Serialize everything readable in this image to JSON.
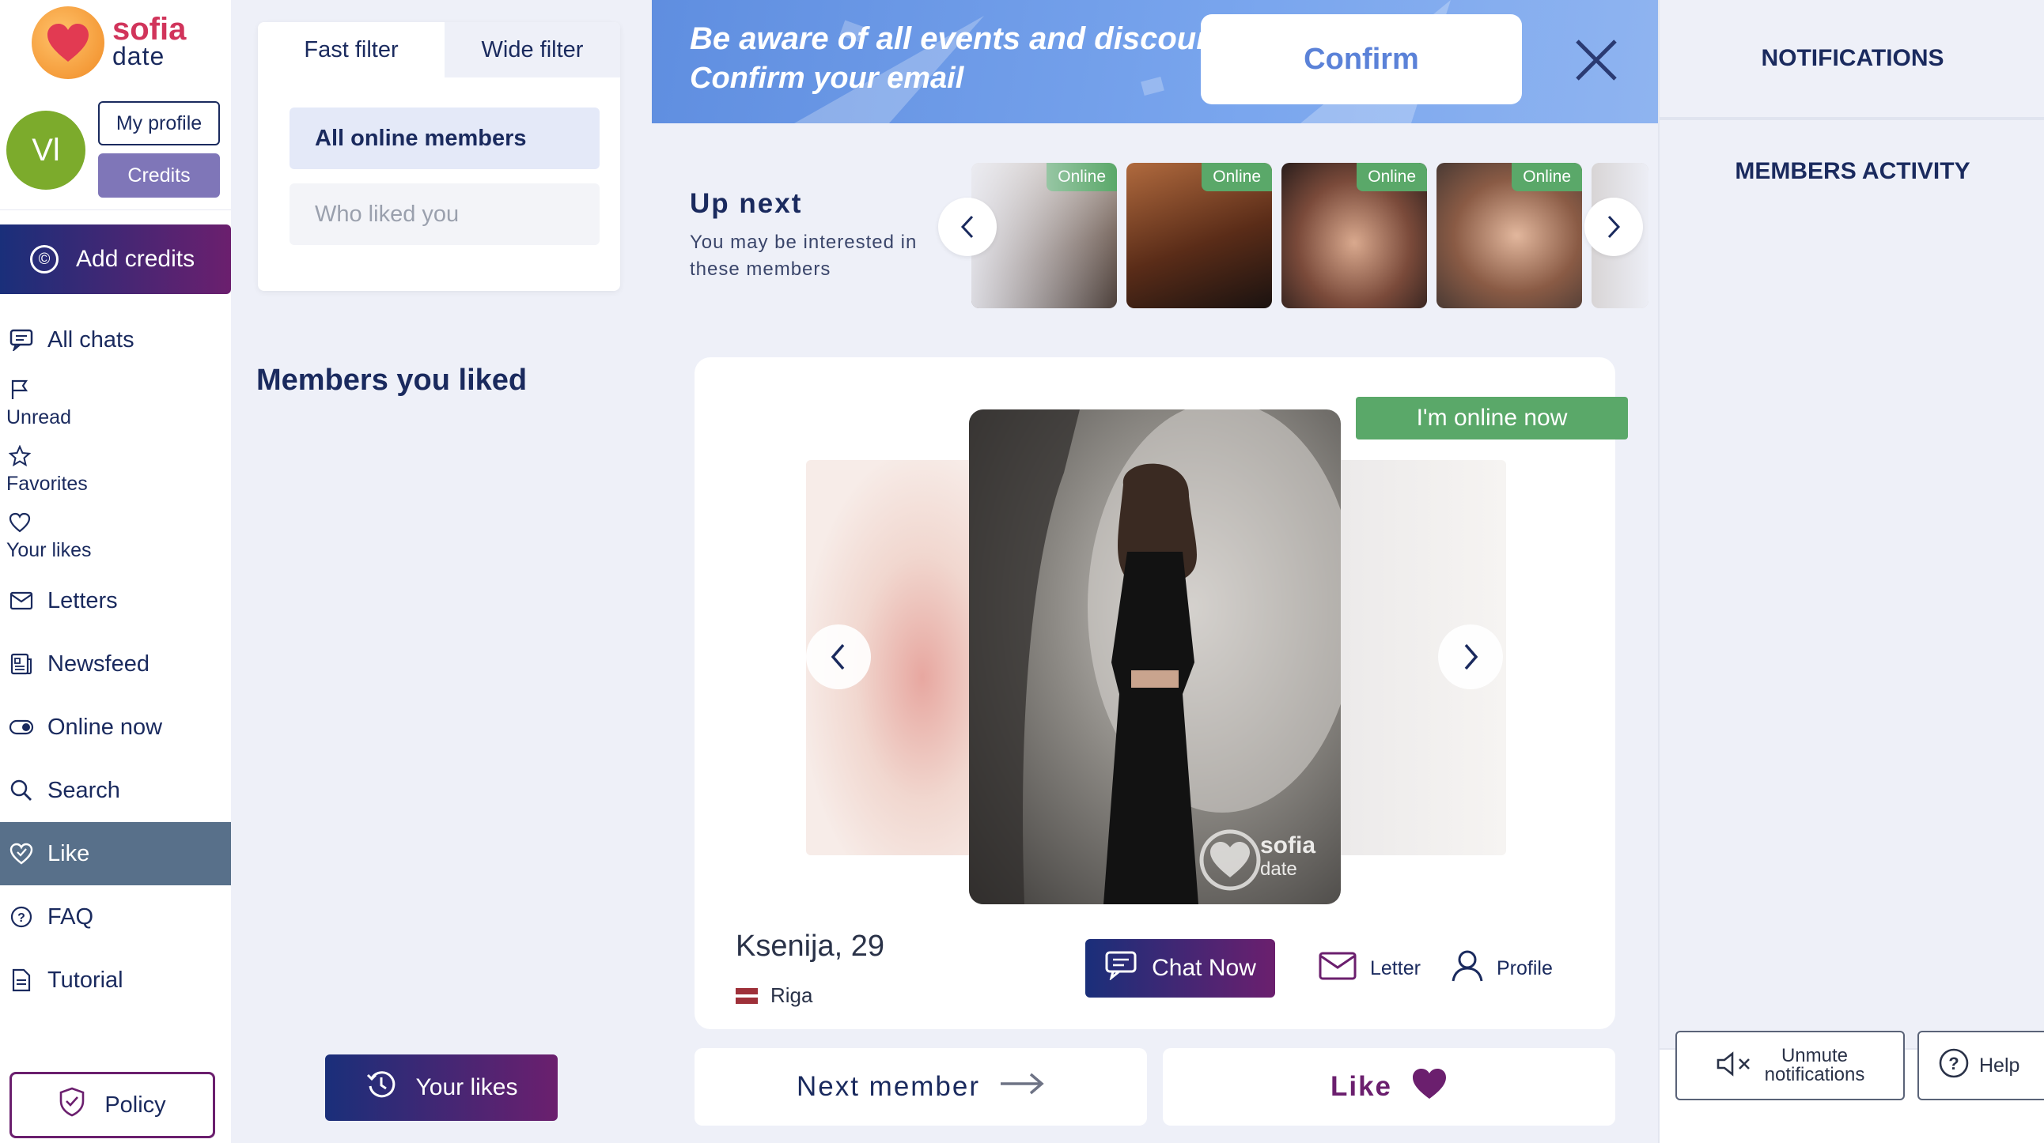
{
  "brand": {
    "line1": "sofia",
    "line2": "date"
  },
  "profile": {
    "avatar_initials": "Vl",
    "my_profile_label": "My profile",
    "credits_label": "Credits"
  },
  "sidebar": {
    "add_credits_label": "Add credits",
    "items": [
      {
        "label": "All chats",
        "icon": "chat-icon"
      },
      {
        "label": "Unread",
        "icon": "flag-icon"
      },
      {
        "label": "Favorites",
        "icon": "star-icon"
      },
      {
        "label": "Your likes",
        "icon": "heart-outline-icon"
      },
      {
        "label": "Letters",
        "icon": "envelope-icon"
      },
      {
        "label": "Newsfeed",
        "icon": "newsfeed-icon"
      },
      {
        "label": "Online now",
        "icon": "toggle-icon"
      },
      {
        "label": "Search",
        "icon": "search-icon"
      },
      {
        "label": "Like",
        "icon": "heart-check-icon",
        "active": true
      },
      {
        "label": "FAQ",
        "icon": "question-icon"
      },
      {
        "label": "Tutorial",
        "icon": "document-icon"
      }
    ],
    "policy_label": "Policy"
  },
  "filters": {
    "tabs": [
      "Fast filter",
      "Wide filter"
    ],
    "options": [
      "All online members",
      "Who liked you"
    ],
    "members_liked_heading": "Members you liked",
    "your_likes_button": "Your likes"
  },
  "banner": {
    "line1": "Be aware of all events and discounts!",
    "line2": "Confirm your email",
    "confirm_label": "Confirm"
  },
  "up_next": {
    "title": "Up next",
    "subtitle": "You may be interested in these members",
    "badge_label": "Online"
  },
  "member": {
    "online_badge": "I'm online now",
    "name_age": "Ksenija, 29",
    "city": "Riga",
    "chat_now_label": "Chat Now",
    "letter_label": "Letter",
    "profile_label": "Profile",
    "watermark_line1": "sofia",
    "watermark_line2": "date"
  },
  "actions": {
    "next_member_label": "Next member",
    "like_label": "Like"
  },
  "right_panel": {
    "notifications_heading": "NOTIFICATIONS",
    "activity_heading": "MEMBERS ACTIVITY",
    "unmute_line1": "Unmute",
    "unmute_line2": "notifications",
    "help_label": "Help"
  },
  "colors": {
    "navy": "#1a2a5e",
    "plum": "#6b1f6e",
    "online_green": "#5aa869",
    "banner_blue": "#6e9be6",
    "active_nav": "#58708a"
  }
}
